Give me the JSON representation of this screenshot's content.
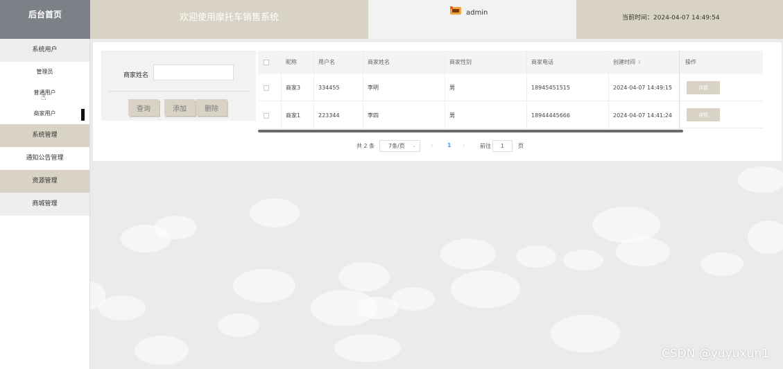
{
  "header": {
    "brand": "后台首页",
    "title": "欢迎使用摩托车销售系统",
    "username": "admin",
    "time_label": "当前时间：",
    "time_value": "2024-04-07 14:49:54"
  },
  "sidebar": {
    "items": [
      {
        "label": "系统用户"
      },
      {
        "label": "管理员"
      },
      {
        "label": "普通用户"
      },
      {
        "label": "商家用户"
      },
      {
        "label": "系统管理"
      },
      {
        "label": "通知公告管理"
      },
      {
        "label": "资源管理"
      },
      {
        "label": "商城管理"
      }
    ]
  },
  "search": {
    "label": "商家姓名",
    "value": "",
    "buttons": {
      "query": "查询",
      "add": "添加",
      "delete": "删除"
    }
  },
  "table": {
    "columns": [
      "昵称",
      "用户名",
      "商家姓名",
      "商家性别",
      "商家电话",
      "创建时间",
      "操作"
    ],
    "rows": [
      {
        "nickname": "商家3",
        "username": "334455",
        "name": "李明",
        "gender": "男",
        "phone": "18945451515",
        "created": "2024-04-07 14:49:15",
        "action": "详情"
      },
      {
        "nickname": "商家1",
        "username": "223344",
        "name": "李四",
        "gender": "男",
        "phone": "18944445666",
        "created": "2024-04-07 14:41:24",
        "action": "详情"
      }
    ]
  },
  "pagination": {
    "total": "共 2 条",
    "page_size": "7条/页",
    "prev": "‹",
    "current": "1",
    "next": "›",
    "goto_prefix": "前往",
    "goto_value": "1",
    "goto_suffix": "页"
  },
  "watermark": "CSDN @yuyuxun1",
  "colors": {
    "accent": "#d8d3c4",
    "brand_bg": "#7d8187",
    "page_bg": "#ebebeb",
    "page_active": "#409eff"
  }
}
